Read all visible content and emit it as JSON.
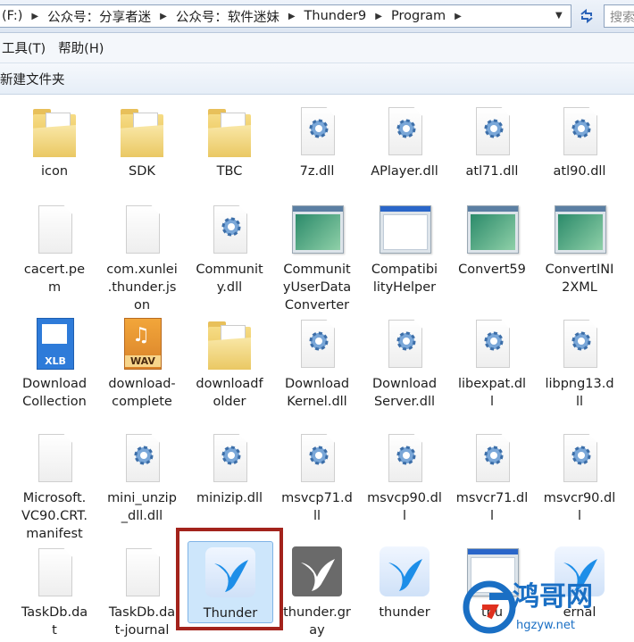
{
  "address": {
    "crumbs": [
      "(F:)",
      "公众号：分享者迷",
      "公众号：软件迷妹",
      "Thunder9",
      "Program"
    ],
    "search_placeholder": "搜索"
  },
  "menu": {
    "items": [
      "工具(T)",
      "帮助(H)"
    ]
  },
  "toolbar": {
    "new_folder": "新建文件夹"
  },
  "files": [
    {
      "label": "icon",
      "icon": "folder-icon"
    },
    {
      "label": "SDK",
      "icon": "folder-icon"
    },
    {
      "label": "TBC",
      "icon": "folder-icon"
    },
    {
      "label": "7z.dll",
      "icon": "dll-icon"
    },
    {
      "label": "APlayer.dll",
      "icon": "dll-icon"
    },
    {
      "label": "atl71.dll",
      "icon": "dll-icon"
    },
    {
      "label": "atl90.dll",
      "icon": "dll-icon"
    },
    {
      "label": "cacert.pe\nm",
      "icon": "file-icon"
    },
    {
      "label": "com.xunlei\n.thunder.js\non",
      "icon": "file-icon"
    },
    {
      "label": "Communit\ny.dll",
      "icon": "dll-icon"
    },
    {
      "label": "Communit\nyUserData\nConverter",
      "icon": "app-icon"
    },
    {
      "label": "Compatibi\nlityHelper",
      "icon": "window-icon"
    },
    {
      "label": "Convert59",
      "icon": "app-icon"
    },
    {
      "label": "ConvertINI\n2XML",
      "icon": "app-icon"
    },
    {
      "label": "Download\nCollection",
      "icon": "xlb-icon"
    },
    {
      "label": "download-\ncomplete",
      "icon": "wav-icon"
    },
    {
      "label": "downloadf\nolder",
      "icon": "folder-icon"
    },
    {
      "label": "Download\nKernel.dll",
      "icon": "dll-icon"
    },
    {
      "label": "Download\nServer.dll",
      "icon": "dll-icon"
    },
    {
      "label": "libexpat.dl\nl",
      "icon": "dll-icon"
    },
    {
      "label": "libpng13.d\nll",
      "icon": "dll-icon"
    },
    {
      "label": "Microsoft.\nVC90.CRT.\nmanifest",
      "icon": "file-icon"
    },
    {
      "label": "mini_unzip\n_dll.dll",
      "icon": "dll-icon"
    },
    {
      "label": "minizip.dll",
      "icon": "dll-icon"
    },
    {
      "label": "msvcp71.d\nll",
      "icon": "dll-icon"
    },
    {
      "label": "msvcp90.dl\nl",
      "icon": "dll-icon"
    },
    {
      "label": "msvcr71.dl\nl",
      "icon": "dll-icon"
    },
    {
      "label": "msvcr90.dl\nl",
      "icon": "dll-icon"
    },
    {
      "label": "TaskDb.da\nt",
      "icon": "file-icon"
    },
    {
      "label": "TaskDb.da\nt-journal",
      "icon": "file-icon"
    },
    {
      "label": "Thunder",
      "icon": "thunder-bird-icon",
      "selected": true
    },
    {
      "label": "thunder.gr\nay",
      "icon": "thunder-gray-icon"
    },
    {
      "label": "thunder",
      "icon": "thunder-bird-icon"
    },
    {
      "label": "thu",
      "icon": "window-icon"
    },
    {
      "label": "ernal",
      "icon": "thunder-bird-icon"
    }
  ],
  "watermark": {
    "text": "鸿哥网",
    "url_text": "hgzyw.net"
  }
}
